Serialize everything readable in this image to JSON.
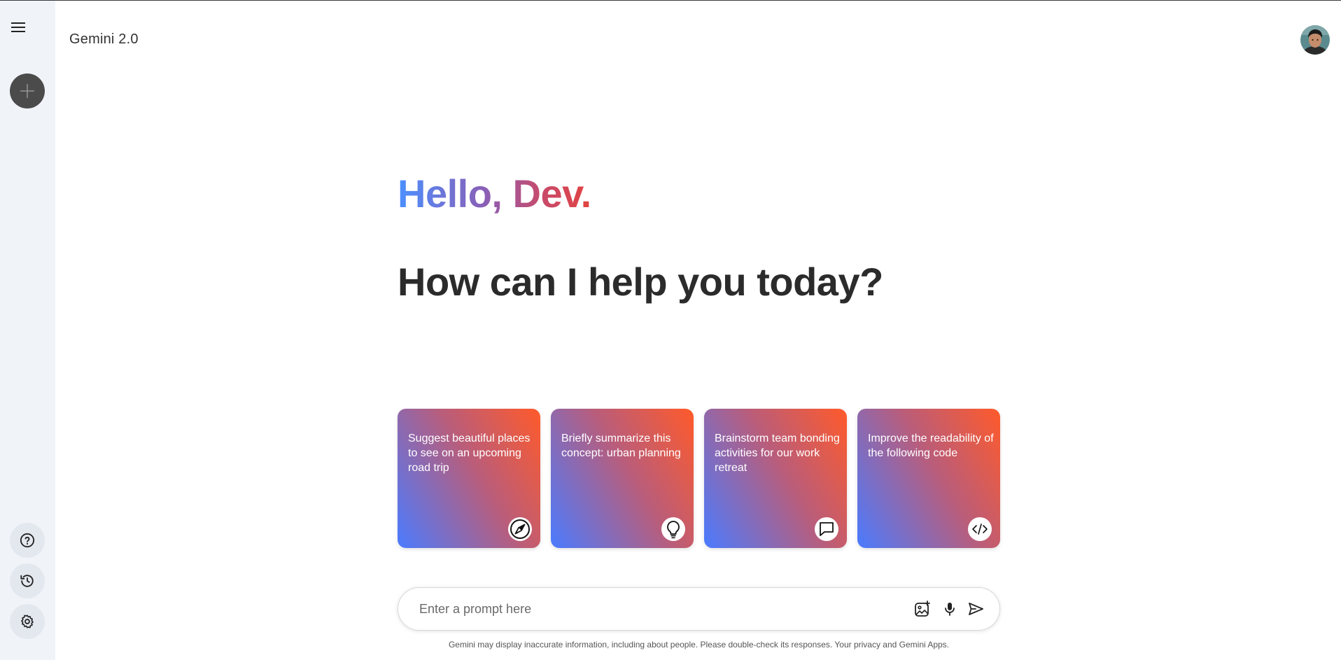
{
  "app": {
    "title": "Gemini 2.0"
  },
  "sidebar": {
    "menu_icon": "menu-icon",
    "new_chat_icon": "plus-icon",
    "bottom": [
      {
        "name": "help",
        "icon": "help-icon"
      },
      {
        "name": "activity",
        "icon": "history-icon"
      },
      {
        "name": "settings",
        "icon": "gear-icon"
      }
    ]
  },
  "header": {
    "avatar_icon": "user-avatar"
  },
  "main": {
    "greeting": "Hello, Dev.",
    "subtitle": "How can I help you today?",
    "cards": [
      {
        "text": "Suggest beautiful places to see on an upcoming road trip",
        "icon": "compass-icon"
      },
      {
        "text": "Briefly summarize this concept: urban planning",
        "icon": "lightbulb-icon"
      },
      {
        "text": "Brainstorm team bonding activities for our work retreat",
        "icon": "chat-bubble-icon"
      },
      {
        "text": "Improve the readability of the following code",
        "icon": "code-icon"
      }
    ]
  },
  "prompt": {
    "placeholder": "Enter a prompt here",
    "value": "",
    "icons": [
      "image-upload-icon",
      "microphone-icon",
      "send-icon"
    ]
  },
  "footer": {
    "disclaimer": "Gemini may display inaccurate information, including about people. Please double-check its responses. Your privacy and Gemini Apps."
  },
  "colors": {
    "sidebar_bg": "#f0f4f9",
    "greeting_gradient_start": "#4b90ff",
    "greeting_gradient_end": "#e2433f",
    "card_gradient_start": "#4a7bff",
    "card_gradient_end": "#ff5a2a"
  }
}
